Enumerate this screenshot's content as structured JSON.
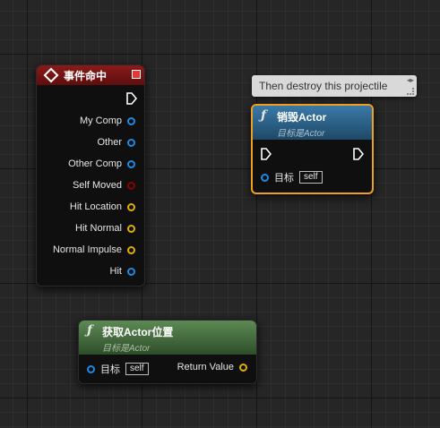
{
  "event_node": {
    "title": "事件命中",
    "pins": [
      {
        "label": "My Comp",
        "color": "#1e88e5"
      },
      {
        "label": "Other",
        "color": "#1e88e5"
      },
      {
        "label": "Other Comp",
        "color": "#1e88e5"
      },
      {
        "label": "Self Moved",
        "color": "#8b0000"
      },
      {
        "label": "Hit Location",
        "color": "#e0b000"
      },
      {
        "label": "Hit Normal",
        "color": "#e0b000"
      },
      {
        "label": "Normal Impulse",
        "color": "#e0b000"
      },
      {
        "label": "Hit",
        "color": "#1e88e5"
      }
    ],
    "header_color": "#7a1313"
  },
  "comment_bubble": {
    "text": "Then destroy this projectile"
  },
  "destroy_node": {
    "icon": "function-icon",
    "title": "销毁Actor",
    "subtitle": "目标是Actor",
    "target_label": "目标",
    "target_value": "self",
    "header_color": "#2d5c7f",
    "selected_border": "#f0a020"
  },
  "location_node": {
    "icon": "function-icon",
    "title": "获取Actor位置",
    "subtitle": "目标是Actor",
    "target_label": "目标",
    "target_value": "self",
    "return_label": "Return Value",
    "header_color": "#3f6a3a"
  }
}
